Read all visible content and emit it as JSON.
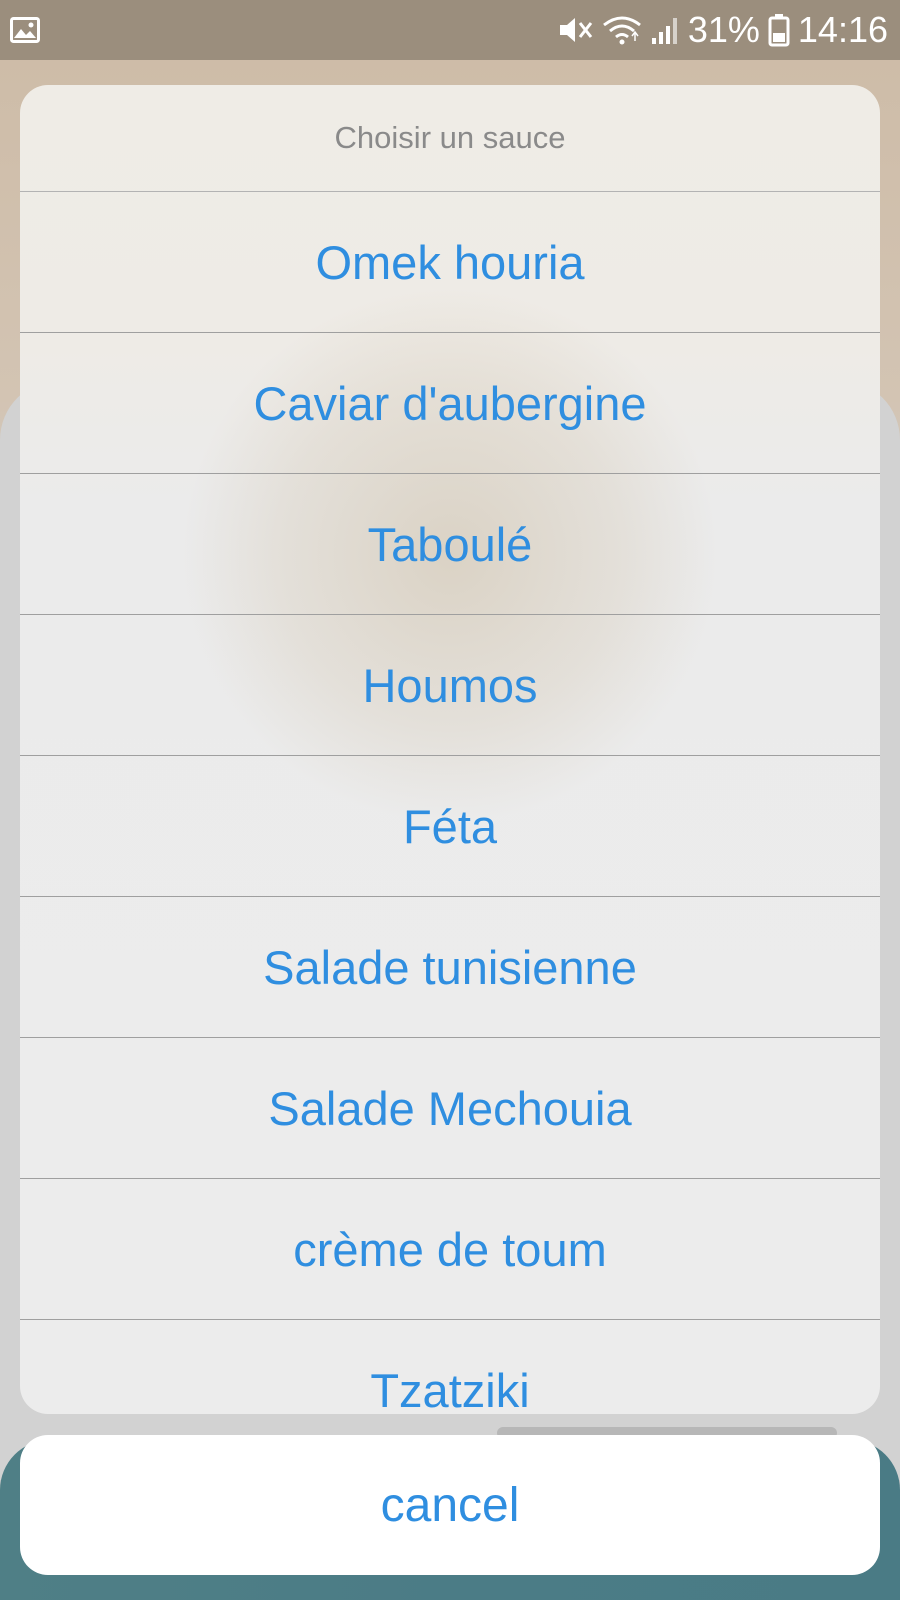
{
  "status_bar": {
    "battery_percent": "31%",
    "time": "14:16",
    "icons": [
      "gallery-icon",
      "mute-icon",
      "wifi-icon",
      "signal-icon",
      "battery-icon"
    ]
  },
  "sheet": {
    "title": "Choisir un sauce",
    "options": [
      "Omek houria",
      "Caviar d'aubergine",
      "Taboulé",
      "Houmos",
      "Féta",
      "Salade tunisienne",
      "Salade Mechouia",
      "crème de toum",
      "Tzatziki"
    ]
  },
  "cancel_label": "cancel",
  "colors": {
    "accent": "#2f8ee0",
    "status_bar": "#9b8e7d",
    "bottom_bar": "#4b7c86"
  }
}
